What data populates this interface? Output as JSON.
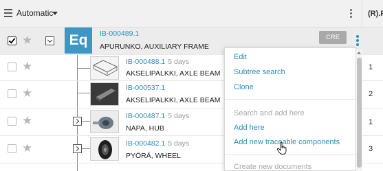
{
  "header": {
    "view_label": "Automatic",
    "column_label": "(R).P"
  },
  "root": {
    "logo_text": "Eq",
    "id": "IB-000489.1",
    "name": "APURUNKO, AUXILIARY FRAME",
    "badge": "CRE",
    "checked": true
  },
  "children": [
    {
      "id": "IB-000488.1",
      "age": "5 days",
      "name": "AKSELIPALKKI, AXLE BEAM",
      "value": "1",
      "image": "beam-frame"
    },
    {
      "id": "IB-000537.1",
      "age": "",
      "name": "AKSELIPALKKI, AXLE BEAM",
      "value": "2",
      "image": "beam-photo"
    },
    {
      "id": "IB-000487.1",
      "age": "5 days",
      "name": "NAPA, HUB",
      "value": "1",
      "image": "hub-photo"
    },
    {
      "id": "IB-000482.1",
      "age": "5 days",
      "name": "PYÖRÄ, WHEEL",
      "value": "3",
      "image": "wheel-photo"
    }
  ],
  "context_menu": {
    "items": [
      {
        "label": "Edit",
        "enabled": true
      },
      {
        "label": "Subtree search",
        "enabled": true
      },
      {
        "label": "Clone",
        "enabled": true
      },
      {
        "label": "Search and add here",
        "enabled": false
      },
      {
        "label": "Add here",
        "enabled": true
      },
      {
        "label": "Add new traceable components",
        "enabled": true
      },
      {
        "label": "Create new documents",
        "enabled": false
      }
    ]
  },
  "colors": {
    "accent": "#2e8fb8",
    "logo_bg": "#3c97c2",
    "badge_bg": "#a9a9a9",
    "disabled_text": "#a9a9a9"
  },
  "icons": [
    "hamburger-icon",
    "caret-down-icon",
    "kebab-icon",
    "star-icon",
    "checkbox-icon",
    "chevron-down-icon",
    "chevron-right-icon",
    "hand-cursor-icon"
  ]
}
